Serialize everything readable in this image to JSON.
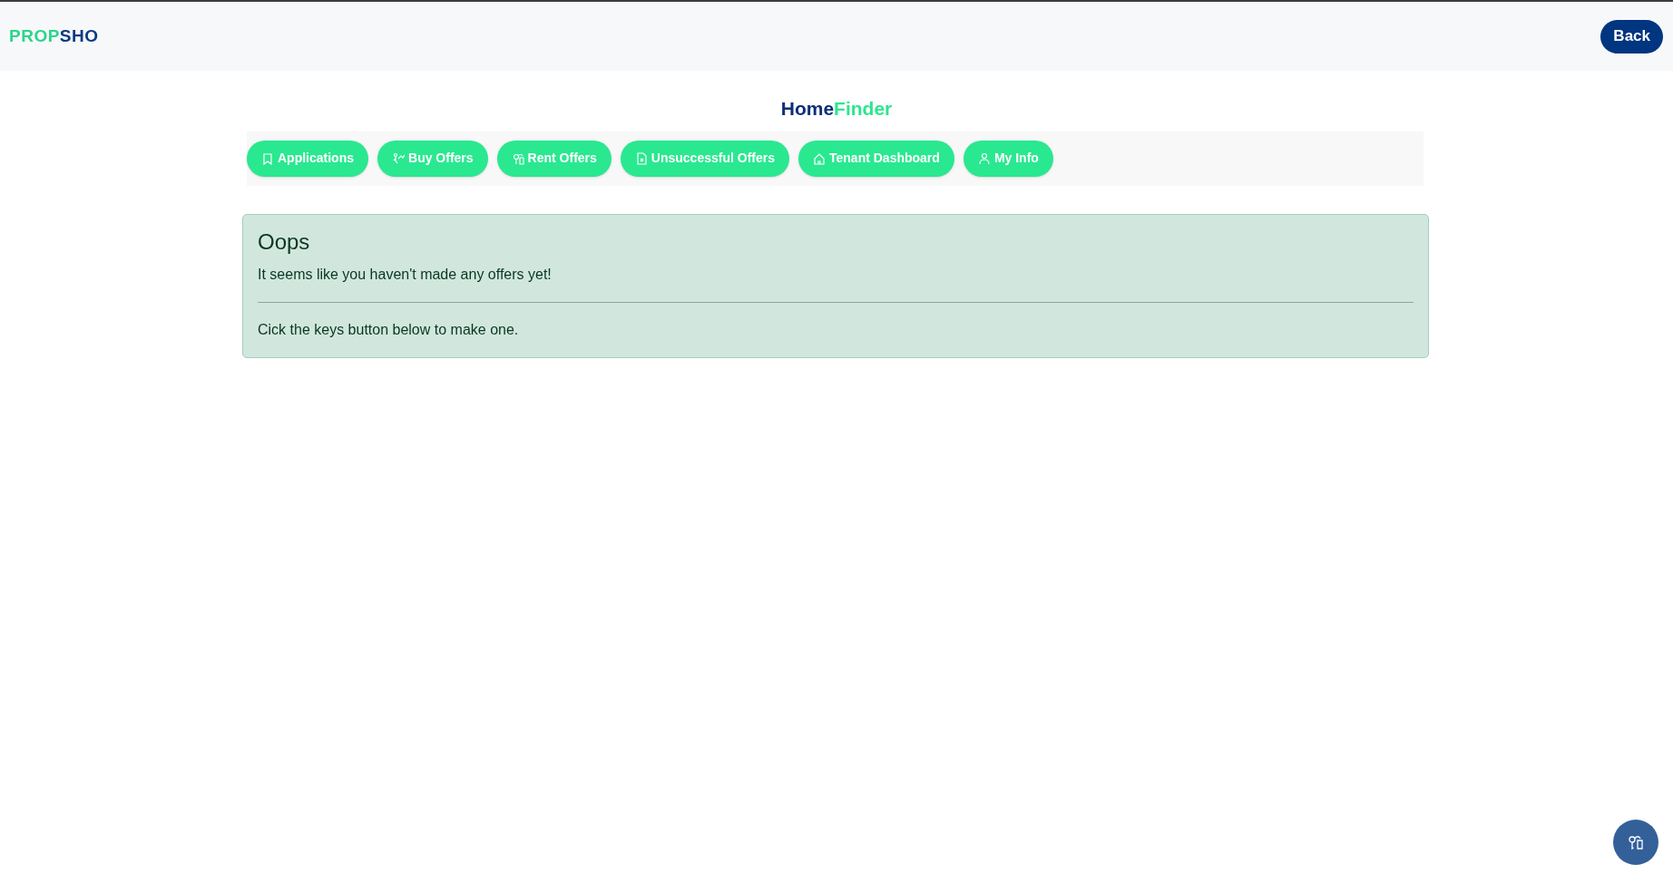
{
  "header": {
    "logo": {
      "part_1": "PROP",
      "part_2": "SHO"
    },
    "back_button": "Back"
  },
  "title": {
    "part_1": "Home",
    "part_2": "Finder"
  },
  "tabs": [
    {
      "label": "Applications"
    },
    {
      "label": "Buy Offers"
    },
    {
      "label": "Rent Offers"
    },
    {
      "label": "Unsuccessful Offers"
    },
    {
      "label": "Tenant Dashboard"
    },
    {
      "label": "My Info"
    }
  ],
  "alert": {
    "heading": "Oops",
    "message": "It seems like you haven't made any offers yet!",
    "hint": "Cick the keys button below to make one."
  }
}
